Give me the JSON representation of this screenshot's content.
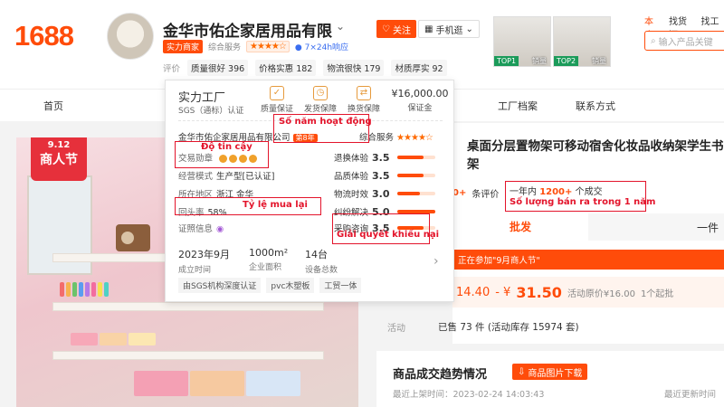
{
  "header": {
    "logo": "1688",
    "shop_name": "金华市佑企家居用品有限",
    "follow": "关注",
    "mobile": "手机逛",
    "badge": "实力商家",
    "overall_label": "综合服务",
    "service_badge": "7×24h响应",
    "metrics_label": "评价",
    "metrics": [
      "质量很好 396",
      "价格实惠 182",
      "物流很快 179",
      "材质厚实 92"
    ],
    "top_products": [
      {
        "badge": "TOP1",
        "sales": "销量"
      },
      {
        "badge": "TOP2",
        "sales": "销量"
      }
    ],
    "top_links": [
      "本店",
      "找货源",
      "找工厂"
    ],
    "search_placeholder": "输入产品关键"
  },
  "nav": {
    "items": [
      "首页",
      "工厂档案",
      "联系方式"
    ]
  },
  "product_image": {
    "sale_date": "9.12",
    "sale_text": "商人节"
  },
  "right": {
    "title": "桌面分层置物架可移动宿舍化妆品收纳架学生书架",
    "review_prefix": "0+",
    "review_label": "条评价",
    "sold_text": "一年内",
    "sold_count": "1200+",
    "sold_suffix": "个成交",
    "tab_batch": "批发",
    "tab_piece": "一件",
    "event": "正在参加\"9月商人节\"",
    "price_low": "14.40",
    "price_sep": "- ¥",
    "price_high": "31.50",
    "price_note": "活动原价¥16.00",
    "moq": "1个起批",
    "activity_label": "活动",
    "stock": "已售 73 件 (活动库存 15974 套)"
  },
  "trend": {
    "title": "商品成交趋势情况",
    "download": "商品图片下载",
    "updated": "最近上架时间：2023-02-24 14:03:43",
    "latest": "最近更新时间"
  },
  "popup": {
    "title": "实力工厂",
    "subtitle": "SGS（通标）认证",
    "guarantees": [
      {
        "label": "质量保证",
        "icon": "quality-icon"
      },
      {
        "label": "发货保障",
        "icon": "shipping-icon"
      },
      {
        "label": "换货保障",
        "icon": "exchange-icon"
      }
    ],
    "deposit": "¥16,000.00",
    "deposit_label": "保证金",
    "company": "金华市佑企家居用品有限公司",
    "years": "第8年",
    "overall": "综合服务",
    "rows": [
      {
        "k": "交易勋章",
        "v": ""
      },
      {
        "k": "经营模式",
        "v": "生产型[已认证]"
      },
      {
        "k": "所在地区",
        "v": "浙江 金华"
      },
      {
        "k": "回头率",
        "v": "58%"
      },
      {
        "k": "证照信息",
        "v": ""
      }
    ],
    "ratings": [
      {
        "label": "退换体验",
        "value": "3.5",
        "fill": 0.7
      },
      {
        "label": "品质体验",
        "value": "3.5",
        "fill": 0.7
      },
      {
        "label": "物流时效",
        "value": "3.0",
        "fill": 0.6
      },
      {
        "label": "纠纷解决",
        "value": "5.0",
        "fill": 1.0
      },
      {
        "label": "采购咨询",
        "value": "3.5",
        "fill": 0.7
      }
    ],
    "stats": [
      {
        "v": "2023年9月",
        "s": "成立时间"
      },
      {
        "v": "1000m²",
        "s": "企业面积"
      },
      {
        "v": "14台",
        "s": "设备总数"
      }
    ],
    "tags": [
      "由SGS机构深度认证",
      "pvc木塑板",
      "工贸一体"
    ]
  },
  "annotations": {
    "years": "Số năm hoạt động",
    "trust": "Độ tin cậy",
    "repurchase": "Tỷ lệ mua lại",
    "sold": "Số lượng bán ra trong 1 năm",
    "complaints": "Giải quyết khiếu nại"
  },
  "colors": {
    "accent": "#ff4c0a",
    "annotation": "#e3142b"
  }
}
